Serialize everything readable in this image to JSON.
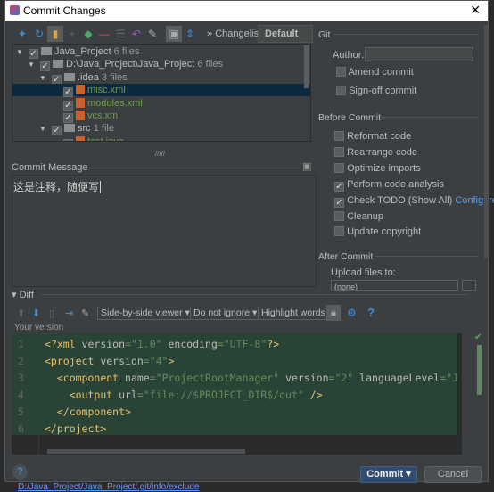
{
  "window": {
    "title": "Commit Changes",
    "close": "✕"
  },
  "toolbar": {
    "changelist_label": "Changelist:",
    "changelist_value": "Default"
  },
  "tree": [
    {
      "label": "Java_Project",
      "count": "6 files",
      "depth": 0,
      "type": "module"
    },
    {
      "label": "D:\\Java_Project\\Java_Project",
      "count": "6 files",
      "depth": 1,
      "type": "folder"
    },
    {
      "label": ".idea",
      "count": "3 files",
      "depth": 2,
      "type": "folder"
    },
    {
      "label": "misc.xml",
      "count": "",
      "depth": 3,
      "type": "xml",
      "selected": true
    },
    {
      "label": "modules.xml",
      "count": "",
      "depth": 3,
      "type": "xml"
    },
    {
      "label": "vcs.xml",
      "count": "",
      "depth": 3,
      "type": "xml"
    },
    {
      "label": "src",
      "count": "1 file",
      "depth": 2,
      "type": "folder"
    },
    {
      "label": "test.java",
      "count": "",
      "depth": 3,
      "type": "java"
    }
  ],
  "commit_message": {
    "label": "Commit Message",
    "value": "这是注释，随便写"
  },
  "git": {
    "label": "Git",
    "author_label": "Author:",
    "author_value": "",
    "amend": "Amend commit",
    "signoff": "Sign-off commit"
  },
  "before_commit": {
    "label": "Before Commit",
    "options": [
      {
        "label": "Reformat code",
        "checked": false
      },
      {
        "label": "Rearrange code",
        "checked": false
      },
      {
        "label": "Optimize imports",
        "checked": false
      },
      {
        "label": "Perform code analysis",
        "checked": true
      },
      {
        "label": "Check TODO (Show All)",
        "checked": true,
        "link": "Configure"
      },
      {
        "label": "Cleanup",
        "checked": false
      },
      {
        "label": "Update copyright",
        "checked": false
      }
    ]
  },
  "after_commit": {
    "label": "After Commit",
    "upload_label": "Upload files to:",
    "upload_value": "(none)"
  },
  "diff": {
    "label": "Diff",
    "viewer": "Side-by-side viewer",
    "ignore": "Do not ignore",
    "highlight": "Highlight words",
    "help": "?",
    "your_version": "Your version",
    "lines": [
      "1",
      "2",
      "3",
      "4",
      "5",
      "6"
    ]
  },
  "buttons": {
    "help": "?",
    "commit": "Commit",
    "cancel": "Cancel"
  },
  "background": {
    "link": "D:/Java_Project/Java_Project/.git/info/exclude"
  },
  "colors": {
    "bg": "#3c3f41",
    "selection": "#0d293e",
    "added": "#294436",
    "link": "#589df6"
  }
}
